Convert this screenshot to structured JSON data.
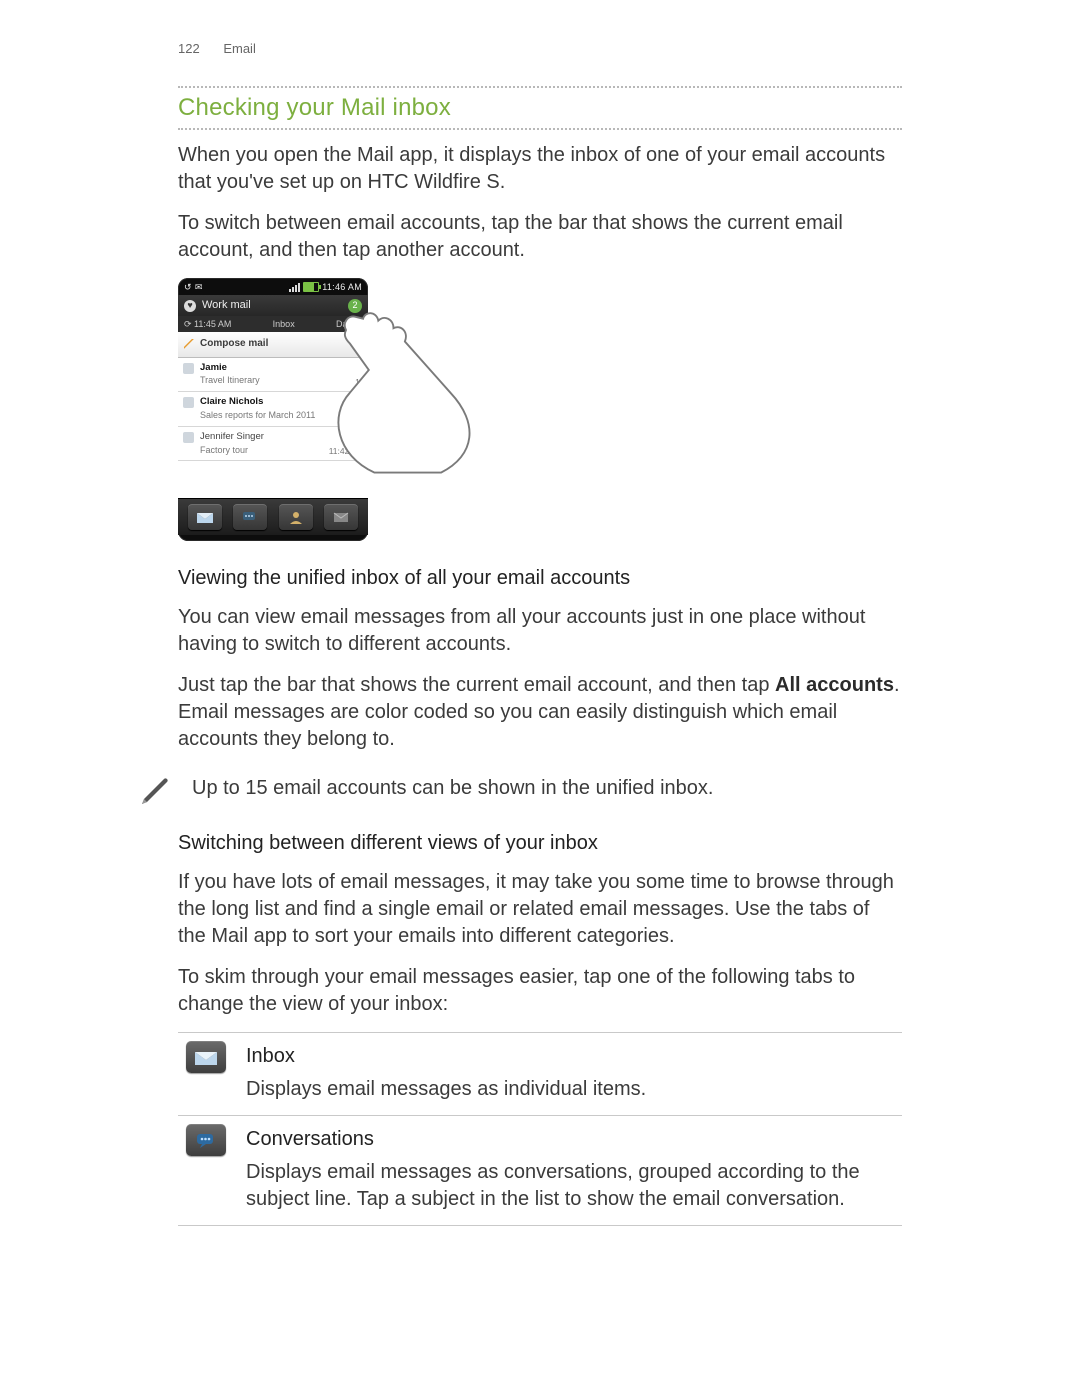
{
  "header": {
    "page_number": "122",
    "section": "Email"
  },
  "section_title": "Checking your Mail inbox",
  "intro_para_1": "When you open the Mail app, it displays the inbox of one of your email accounts that you've set up on HTC Wildfire S.",
  "intro_para_2": "To switch between email accounts, tap the bar that shows the current email account, and then tap another account.",
  "phone": {
    "status_time": "11:46 AM",
    "mail_header": "Work mail",
    "badge": "2",
    "sub_left": "11:45 AM",
    "sub_mid": "Inbox",
    "sub_right": "Date ↓",
    "compose": "Compose mail",
    "items": [
      {
        "from": "Jamie",
        "subject": "Travel Itinerary",
        "time": "11"
      },
      {
        "from": "Claire Nichols",
        "subject": "Sales reports for March 2011",
        "time": "11"
      },
      {
        "from": "Jennifer Singer",
        "subject": "Factory tour",
        "time": "11:42 AM"
      }
    ]
  },
  "unified": {
    "heading": "Viewing the unified inbox of all your email accounts",
    "para_1": "You can view email messages from all your accounts just in one place without having to switch to different accounts.",
    "para_2a": "Just tap the bar that shows the current email account, and then tap ",
    "para_2_bold": "All accounts",
    "para_2b": ". Email messages are color coded so you can easily distinguish which email accounts they belong to."
  },
  "note_text": "Up to 15 email accounts can be shown in the unified inbox.",
  "switching": {
    "heading": "Switching between different views of your inbox",
    "para_1": "If you have lots of email messages, it may take you some time to browse through the long list and find a single email or related email messages. Use the tabs of the Mail app to sort your emails into different categories.",
    "para_2": "To skim through your email messages easier, tap one of the following tabs to change the view of your inbox:"
  },
  "tabs": [
    {
      "title": "Inbox",
      "desc": "Displays email messages as individual items."
    },
    {
      "title": "Conversations",
      "desc": "Displays email messages as conversations, grouped according to the subject line. Tap a subject in the list to show the email conversation."
    }
  ]
}
